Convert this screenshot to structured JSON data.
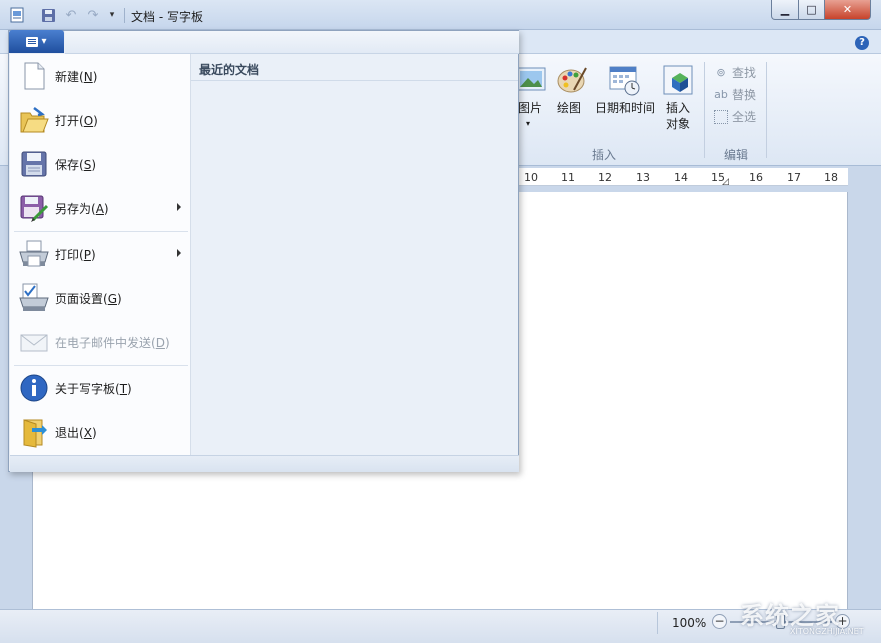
{
  "window": {
    "title": "文档 - 写字板",
    "controls": {
      "minimize": "▁",
      "maximize": "□",
      "close": "✕"
    }
  },
  "quick_access": {
    "items": [
      "app-icon",
      "save-icon",
      "undo-icon",
      "redo-icon",
      "customize-icon"
    ]
  },
  "help": {
    "label": "?"
  },
  "app_menu": {
    "items": [
      {
        "label": "新建",
        "key": "N",
        "icon": "new-document-icon",
        "submenu": false,
        "enabled": true
      },
      {
        "label": "打开",
        "key": "O",
        "icon": "open-folder-icon",
        "submenu": false,
        "enabled": true
      },
      {
        "label": "保存",
        "key": "S",
        "icon": "save-disk-icon",
        "submenu": false,
        "enabled": true
      },
      {
        "label": "另存为",
        "key": "A",
        "icon": "save-as-icon",
        "submenu": true,
        "enabled": true
      },
      {
        "label": "打印",
        "key": "P",
        "icon": "printer-icon",
        "submenu": true,
        "enabled": true
      },
      {
        "label": "页面设置",
        "key": "G",
        "icon": "page-setup-icon",
        "submenu": false,
        "enabled": true
      },
      {
        "label": "在电子邮件中发送",
        "key": "D",
        "icon": "email-icon",
        "submenu": false,
        "enabled": false
      },
      {
        "label": "关于写字板",
        "key": "T",
        "icon": "info-icon",
        "submenu": false,
        "enabled": true
      },
      {
        "label": "退出",
        "key": "X",
        "icon": "exit-icon",
        "submenu": false,
        "enabled": true
      }
    ],
    "recent_title": "最近的文档"
  },
  "ribbon": {
    "insert_group": {
      "label": "插入",
      "picture": "图片",
      "paint": "绘图",
      "datetime": "日期和时间",
      "object_line1": "插入",
      "object_line2": "对象"
    },
    "edit_group": {
      "label": "编辑",
      "find": "查找",
      "replace": "替换",
      "select_all": "全选"
    }
  },
  "ruler": {
    "ticks": [
      "10",
      "11",
      "12",
      "13",
      "14",
      "15",
      "16",
      "17",
      "18"
    ]
  },
  "status": {
    "zoom": "100%",
    "zoom_percent": 100,
    "zoom_out": "−",
    "zoom_in": "+"
  },
  "watermark": {
    "text": "系统之家",
    "sub": "XITONGZHIJIA.NET"
  }
}
